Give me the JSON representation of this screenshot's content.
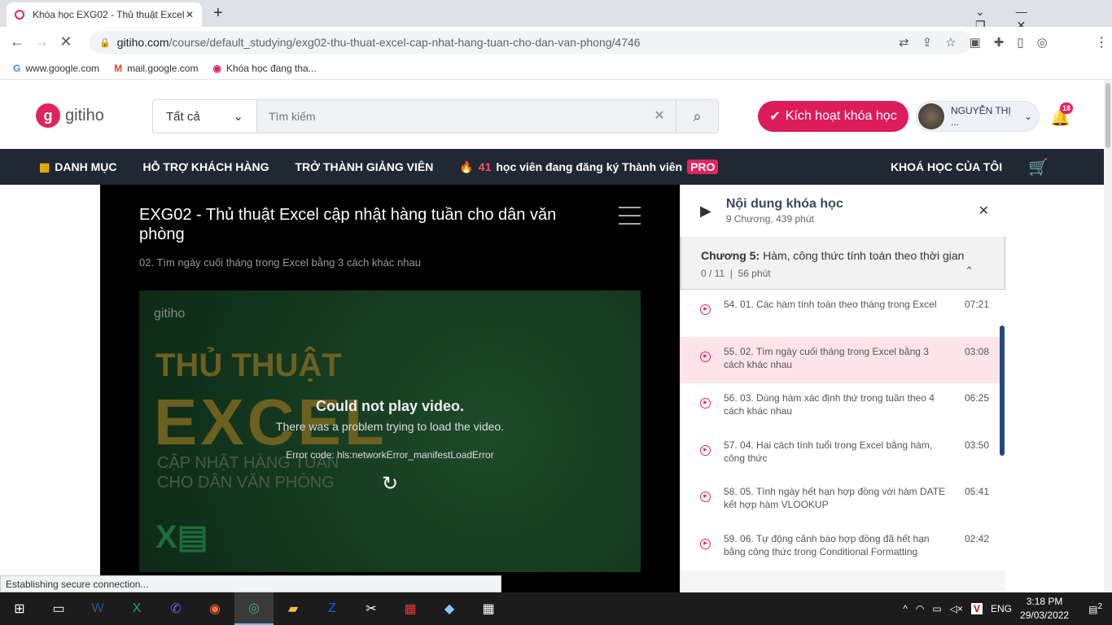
{
  "browser": {
    "tab_title": "Khóa học EXG02 - Thủ thuật Excel",
    "new_tab": "+",
    "url_host": "gitiho.com",
    "url_path": "/course/default_studying/exg02-thu-thuat-excel-cap-nhat-hang-tuan-cho-dan-van-phong/4746",
    "bookmarks": [
      "www.google.com",
      "mail.google.com",
      "Khóa học đang tha..."
    ],
    "status": "Establishing secure connection..."
  },
  "header": {
    "logo": "gitiho",
    "search_category": "Tất cả",
    "search_placeholder": "Tìm kiếm",
    "activate": "Kích hoạt khóa học",
    "user": "NGUYỄN THỊ ...",
    "notifications": "18"
  },
  "nav": {
    "catalog": "DANH MỤC",
    "support": "HỖ TRỢ KHÁCH HÀNG",
    "teacher": "TRỞ THÀNH GIẢNG VIÊN",
    "promo_count": "41",
    "promo_text": "học viên đang đăng ký Thành viên",
    "pro": "PRO",
    "my_courses": "KHOÁ HỌC CỦA TÔI"
  },
  "player": {
    "title": "EXG02 - Thủ thuật Excel cập nhật hàng tuần cho dân văn phòng",
    "lesson": "02. Tìm ngày cuối tháng trong Excel bằng 3 cách khác nhau",
    "thumb_logo": "gitiho",
    "thumb_line1": "THỦ THUẬT",
    "thumb_line2": "EXCEL",
    "thumb_line3": "CẬP NHẬT HÀNG TUẦN",
    "thumb_line4": "CHO DÂN VĂN PHÒNG",
    "error_title": "Could not play video.",
    "error_msg": "There was a problem trying to load the video.",
    "error_code": "Error code: hls:networkError_manifestLoadError"
  },
  "sidebar": {
    "title": "Nội dung khóa học",
    "meta": "9 Chương, 439 phút",
    "chapter_label": "Chương 5:",
    "chapter_title": "Hàm, công thức tính toán theo thời gian",
    "chapter_progress": "0 / 11",
    "chapter_duration": "56 phút",
    "lessons": [
      {
        "title": "54. 01. Các hàm tính toán theo tháng trong Excel",
        "time": "07:21"
      },
      {
        "title": "55. 02. Tìm ngày cuối tháng trong Excel bằng 3 cách khác nhau",
        "time": "03:08"
      },
      {
        "title": "56. 03. Dùng hàm xác định thứ trong tuần theo 4 cách khác nhau",
        "time": "06:25"
      },
      {
        "title": "57. 04. Hai cách tính tuổi trong Excel bằng hàm, công thức",
        "time": "03:50"
      },
      {
        "title": "58. 05. Tính ngày hết hạn hợp đồng với hàm DATE kết hợp hàm VLOOKUP",
        "time": "05:41"
      },
      {
        "title": "59. 06. Tự động cảnh báo hợp đồng đã hết hạn bằng công thức trong Conditional Formatting",
        "time": "02:42"
      }
    ]
  },
  "taskbar": {
    "lang": "ENG",
    "time": "3:18 PM",
    "date": "29/03/2022",
    "notif": "2"
  }
}
